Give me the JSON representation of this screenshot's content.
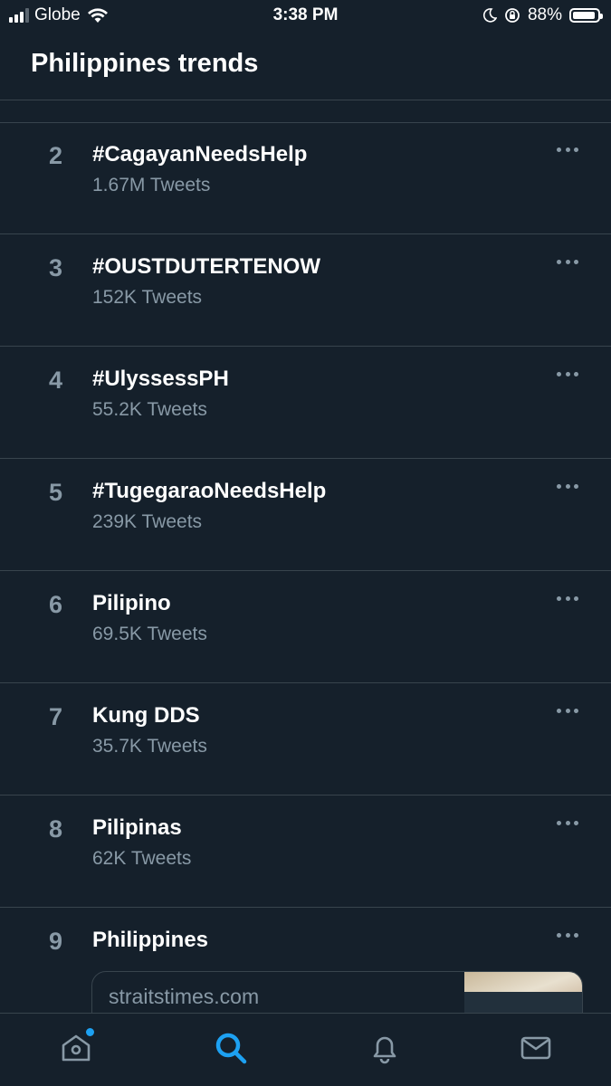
{
  "status_bar": {
    "carrier": "Globe",
    "time": "3:38 PM",
    "battery": "88%",
    "battery_level": 0.88
  },
  "header": {
    "title": "Philippines trends"
  },
  "trends": [
    {
      "rank": "2",
      "name": "#CagayanNeedsHelp",
      "count": "1.67M Tweets"
    },
    {
      "rank": "3",
      "name": "#OUSTDUTERTENOW",
      "count": "152K Tweets"
    },
    {
      "rank": "4",
      "name": "#UlyssessPH",
      "count": "55.2K Tweets"
    },
    {
      "rank": "5",
      "name": "#TugegaraoNeedsHelp",
      "count": "239K Tweets"
    },
    {
      "rank": "6",
      "name": "Pilipino",
      "count": "69.5K Tweets"
    },
    {
      "rank": "7",
      "name": "Kung DDS",
      "count": "35.7K Tweets"
    },
    {
      "rank": "8",
      "name": "Pilipinas",
      "count": "62K Tweets"
    },
    {
      "rank": "9",
      "name": "Philippines",
      "card_domain": "straitstimes.com"
    }
  ],
  "tab_bar": {
    "icons": [
      "home-icon",
      "search-icon",
      "bell-icon",
      "mail-icon"
    ],
    "active_color": "#1da1f2",
    "inactive_color": "#8899a6"
  },
  "colors": {
    "background": "#15202b",
    "divider": "#38444d",
    "secondary_text": "#8899a6",
    "accent": "#1da1f2"
  }
}
